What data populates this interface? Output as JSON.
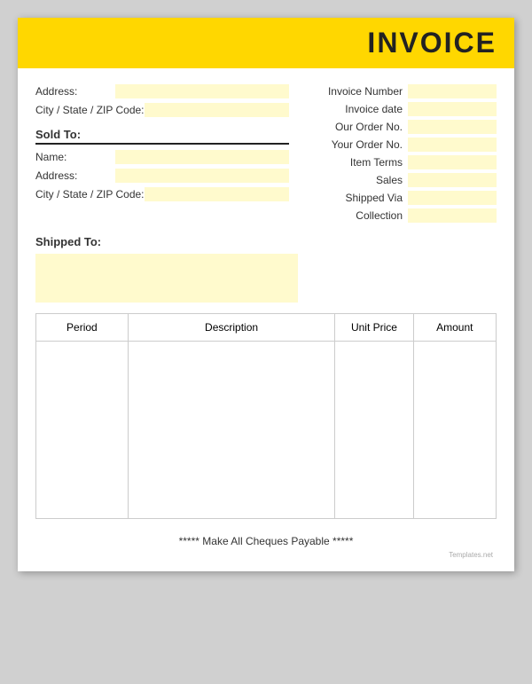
{
  "header": {
    "title": "INVOICE"
  },
  "left_section": {
    "address_label": "Address:",
    "city_label": "City / State / ZIP Code:"
  },
  "sold_to": {
    "label": "Sold To:",
    "name_label": "Name:",
    "address_label": "Address:",
    "city_label": "City / State / ZIP Code:"
  },
  "right_section": {
    "invoice_number_label": "Invoice Number",
    "invoice_date_label": "Invoice date",
    "our_order_label": "Our Order No.",
    "your_order_label": "Your Order No.",
    "item_terms_label": "Item Terms",
    "sales_label": "Sales",
    "shipped_via_label": "Shipped Via",
    "collection_label": "Collection"
  },
  "shipped_to": {
    "label": "Shipped To:"
  },
  "table": {
    "headers": [
      "Period",
      "Description",
      "Unit Price",
      "Amount"
    ]
  },
  "footer": {
    "text": "***** Make All Cheques Payable *****",
    "watermark": "Templates.net"
  }
}
